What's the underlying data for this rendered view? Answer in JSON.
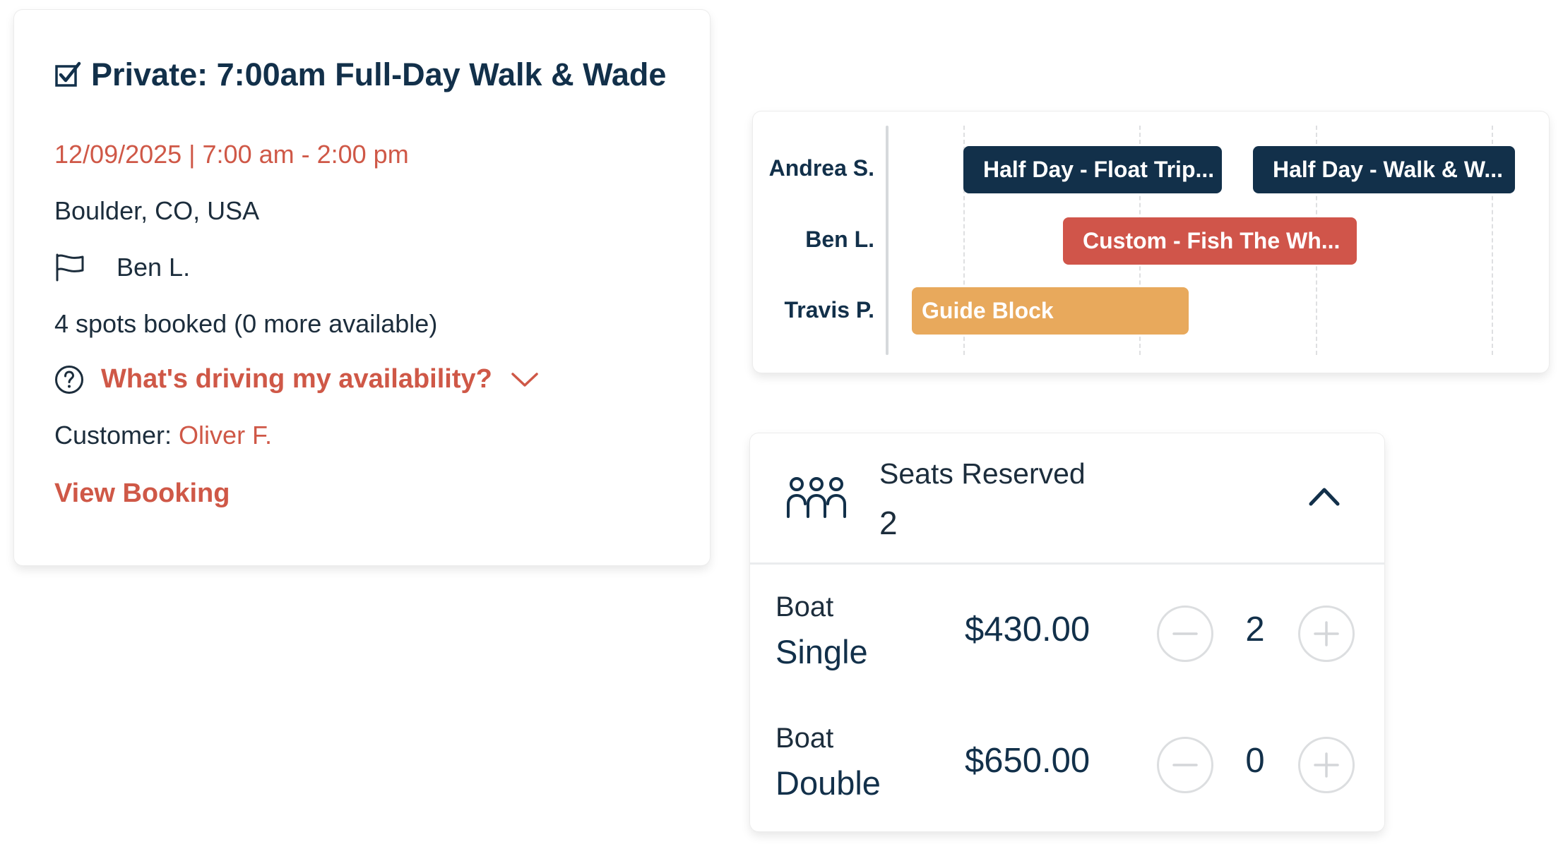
{
  "trip": {
    "title": "Private: 7:00am Full-Day Walk & Wade",
    "date_time": "12/09/2025 | 7:00 am - 2:00 pm",
    "location": "Boulder, CO, USA",
    "guide": "Ben L.",
    "spots": "4 spots booked (0 more available)",
    "availability_link": "What's driving my availability?",
    "customer_label": "Customer:",
    "customer_name": "Oliver F.",
    "view_booking": "View Booking"
  },
  "schedule": {
    "rows": [
      {
        "guide": "Andrea S.",
        "events": [
          "Half Day - Float Trip...",
          "Half Day - Walk & W..."
        ]
      },
      {
        "guide": "Ben L.",
        "events": [
          "Custom - Fish The Wh..."
        ]
      },
      {
        "guide": "Travis P.",
        "events": [
          "Guide Block"
        ]
      }
    ]
  },
  "seats": {
    "label": "Seats Reserved",
    "count": "2",
    "items": [
      {
        "type": "Boat",
        "name": "Single",
        "price": "$430.00",
        "quantity": "2"
      },
      {
        "type": "Boat",
        "name": "Double",
        "price": "$650.00",
        "quantity": "0"
      }
    ]
  },
  "colors": {
    "navy": "#12304a",
    "accent_red": "#cf5847",
    "event_red": "#d0554a",
    "event_orange": "#e8a95c"
  },
  "icons": [
    "check-square-icon",
    "flag-icon",
    "help-circle-icon",
    "chevron-down-icon",
    "people-icon",
    "chevron-up-icon",
    "minus-icon",
    "plus-icon"
  ]
}
